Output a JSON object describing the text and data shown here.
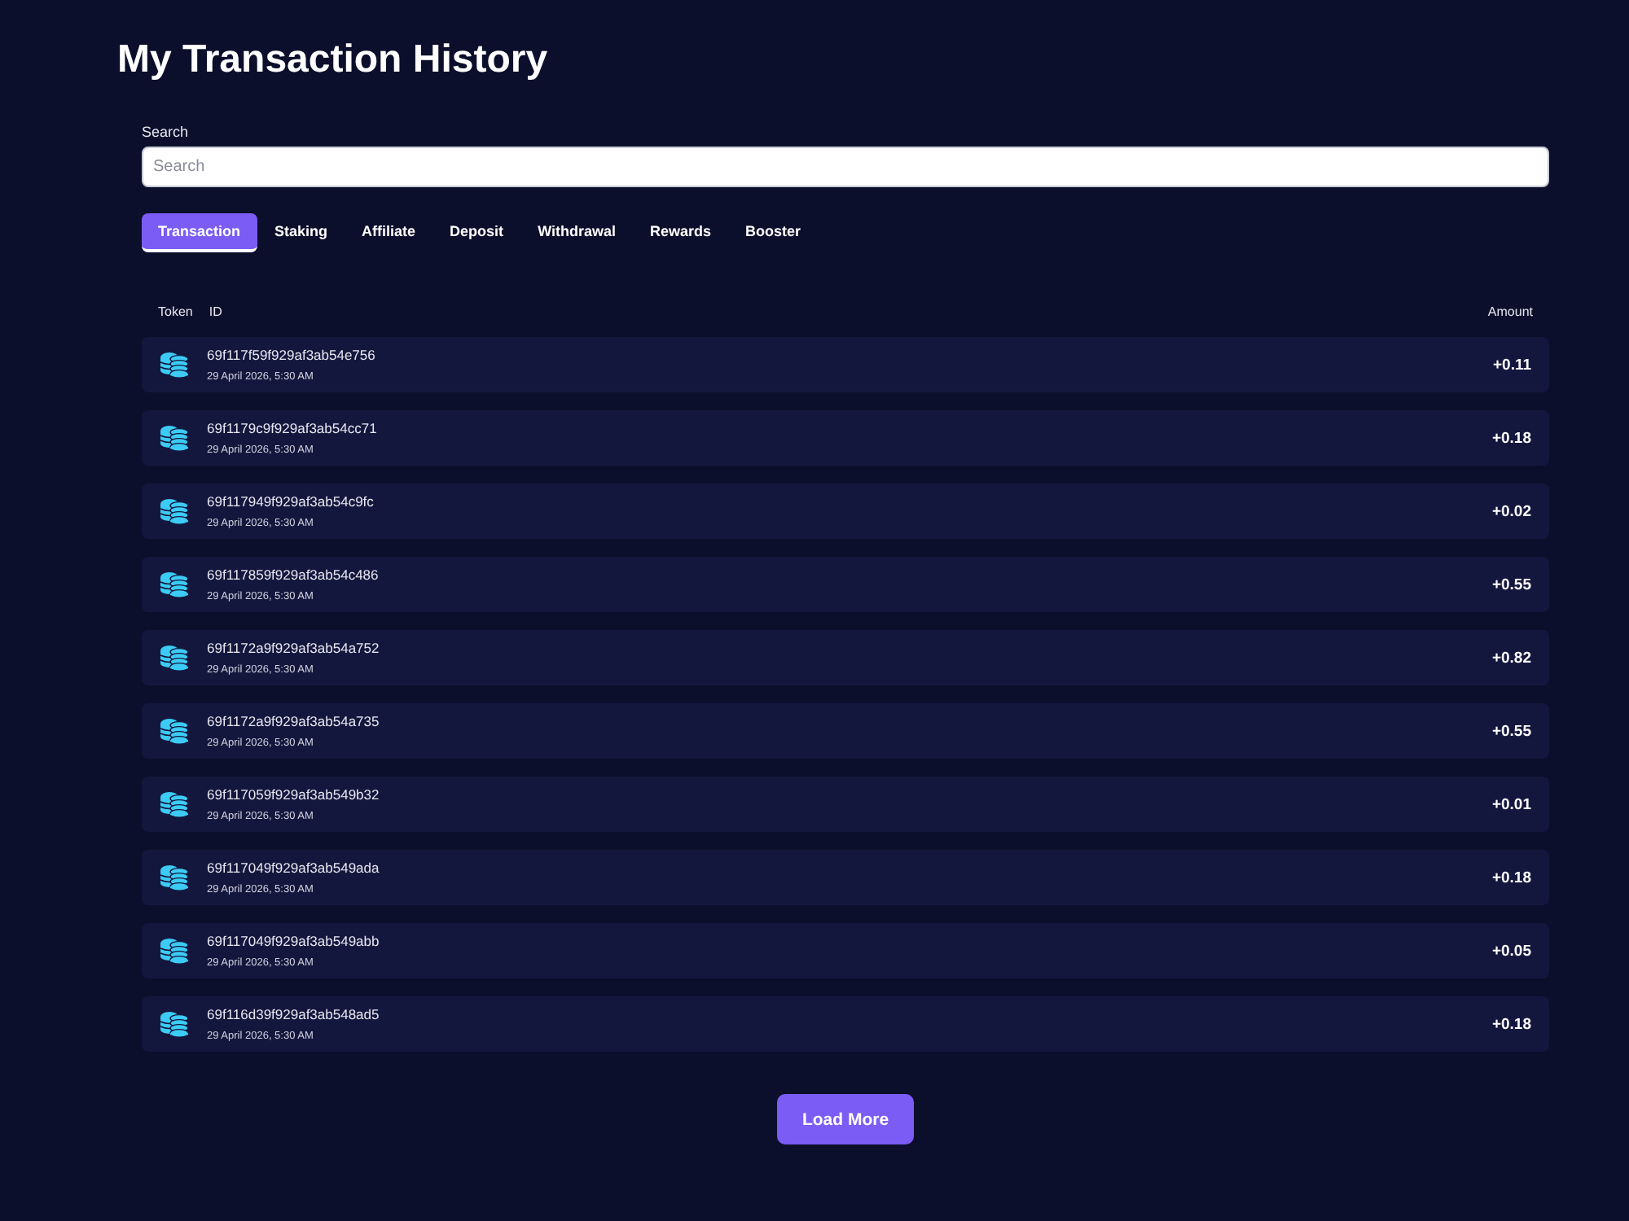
{
  "page": {
    "title": "My Transaction History"
  },
  "search": {
    "label": "Search",
    "placeholder": "Search"
  },
  "tabs": [
    {
      "label": "Transaction",
      "selected": true
    },
    {
      "label": "Staking",
      "selected": false
    },
    {
      "label": "Affiliate",
      "selected": false
    },
    {
      "label": "Deposit",
      "selected": false
    },
    {
      "label": "Withdrawal",
      "selected": false
    },
    {
      "label": "Rewards",
      "selected": false
    },
    {
      "label": "Booster",
      "selected": false
    }
  ],
  "table": {
    "columns": [
      "Token",
      "ID",
      "Amount"
    ],
    "rows": [
      {
        "id": "69f117f59f929af3ab54e756",
        "date": "29 April 2026, 5:30 AM",
        "amount": "+0.11"
      },
      {
        "id": "69f1179c9f929af3ab54cc71",
        "date": "29 April 2026, 5:30 AM",
        "amount": "+0.18"
      },
      {
        "id": "69f117949f929af3ab54c9fc",
        "date": "29 April 2026, 5:30 AM",
        "amount": "+0.02"
      },
      {
        "id": "69f117859f929af3ab54c486",
        "date": "29 April 2026, 5:30 AM",
        "amount": "+0.55"
      },
      {
        "id": "69f1172a9f929af3ab54a752",
        "date": "29 April 2026, 5:30 AM",
        "amount": "+0.82"
      },
      {
        "id": "69f1172a9f929af3ab54a735",
        "date": "29 April 2026, 5:30 AM",
        "amount": "+0.55"
      },
      {
        "id": "69f117059f929af3ab549b32",
        "date": "29 April 2026, 5:30 AM",
        "amount": "+0.01"
      },
      {
        "id": "69f117049f929af3ab549ada",
        "date": "29 April 2026, 5:30 AM",
        "amount": "+0.18"
      },
      {
        "id": "69f117049f929af3ab549abb",
        "date": "29 April 2026, 5:30 AM",
        "amount": "+0.05"
      },
      {
        "id": "69f116d39f929af3ab548ad5",
        "date": "29 April 2026, 5:30 AM",
        "amount": "+0.18"
      }
    ]
  },
  "load_more": {
    "label": "Load More"
  }
}
